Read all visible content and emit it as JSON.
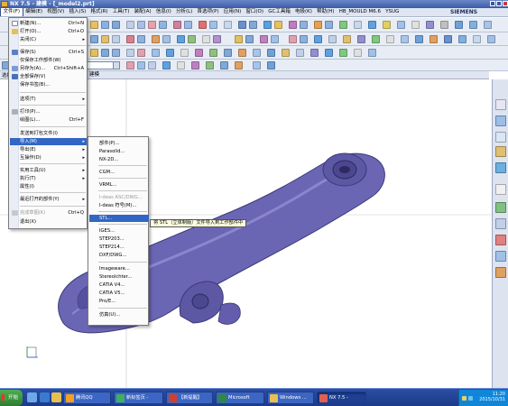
{
  "window": {
    "title": "NX 7.5 - 建模 - [_model2.prt]",
    "brand": "SIEMENS"
  },
  "menubar": {
    "items": [
      "文件(F)",
      "编辑(E)",
      "视图(V)",
      "插入(S)",
      "格式(R)",
      "工具(T)",
      "装配(A)",
      "信息(I)",
      "分析(L)",
      "首选项(P)",
      "应用(N)",
      "窗口(O)",
      "GC工具箱",
      "电极(K)",
      "帮助(H)",
      "HB_MOULD M6.6",
      "YSUG"
    ]
  },
  "graphics": {
    "header_label": "建模"
  },
  "left_panel": {
    "header_label": "选择"
  },
  "file_menu": {
    "items": [
      {
        "label": "新建(N)...",
        "shortcut": "Ctrl+N"
      },
      {
        "label": "打开(O)...",
        "shortcut": "Ctrl+O"
      },
      {
        "label": "关闭(C)",
        "shortcut": ""
      },
      {
        "label": "保存(S)",
        "shortcut": "Ctrl+S"
      },
      {
        "label": "仅保存工作部件(W)",
        "shortcut": ""
      },
      {
        "label": "另存为(A)...",
        "shortcut": "Ctrl+Shift+A"
      },
      {
        "label": "全部保存(V)",
        "shortcut": ""
      },
      {
        "label": "保存书签(B)...",
        "shortcut": ""
      },
      {
        "label": "选项(T)",
        "shortcut": ""
      },
      {
        "label": "打印(P)...",
        "shortcut": ""
      },
      {
        "label": "绘图(L)...",
        "shortcut": "Ctrl+F"
      },
      {
        "label": "发送到打包文件(I)",
        "shortcut": ""
      },
      {
        "label": "导入(M)",
        "shortcut": ""
      },
      {
        "label": "导出(E)",
        "shortcut": ""
      },
      {
        "label": "互操作(D)",
        "shortcut": ""
      },
      {
        "label": "实用工具(U)",
        "shortcut": ""
      },
      {
        "label": "执行(T)",
        "shortcut": ""
      },
      {
        "label": "属性(I)",
        "shortcut": ""
      },
      {
        "label": "最近打开的部件(Y)",
        "shortcut": ""
      },
      {
        "label": "完成草图(K)",
        "shortcut": "Ctrl+Q"
      },
      {
        "label": "退出(X)",
        "shortcut": ""
      }
    ]
  },
  "import_menu": {
    "items": [
      "部件(P)...",
      "Parasolid...",
      "NX-2D...",
      "CGM...",
      "VRML...",
      "I-deas ASC/DWG...",
      "I-deas 符号(M)...",
      "STL...",
      "IGES...",
      "STEP203...",
      "STEP214...",
      "DXF/DWG...",
      "Imageware...",
      "Stereolchter...",
      "CATIA V4...",
      "CATIA V5...",
      "Pro/E...",
      "仿真(U)..."
    ]
  },
  "tooltip": {
    "text": "将 STL（立体制版）文件导入到工作部件中"
  },
  "taskbar": {
    "start_label": "开始",
    "buttons": [
      "腾讯QQ",
      "新标签页 -",
      "【新提醒】",
      "Microsoft",
      "Windows ...",
      "NX 7.5 -"
    ],
    "clock_time": "11:20",
    "clock_date": "2015/10/31"
  },
  "colors": {
    "model": "#6b66b4",
    "highlight": "#3166c4",
    "taskbar": "#2b4ea3"
  }
}
